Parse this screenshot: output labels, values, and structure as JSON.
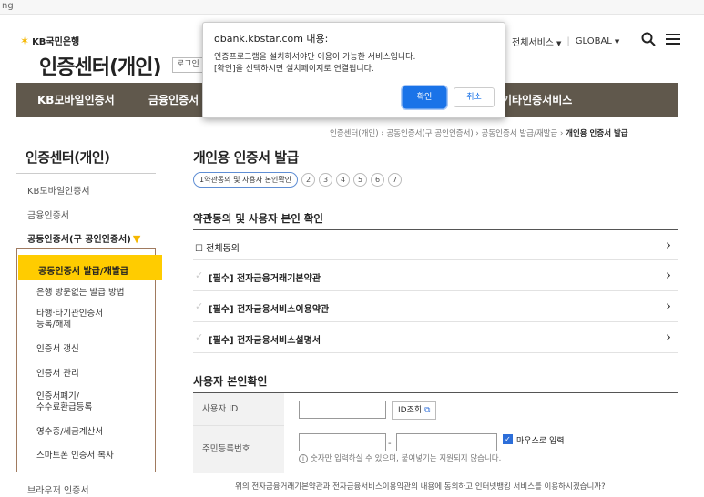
{
  "browser": {
    "tab_fragment": "ng"
  },
  "header": {
    "logo_text": "KB국민은행",
    "site_title": "인증센터(개인)",
    "login_label": "로그인",
    "all_services": "전체서비스",
    "global": "GLOBAL"
  },
  "nav": {
    "items": [
      "KB모바일인증서",
      "금융인증서",
      "기타인증서비스"
    ]
  },
  "breadcrumb": {
    "items": [
      "인증센터(개인)",
      "공동인증서(구 공인인증서)",
      "공동인증서 발급/재발급"
    ],
    "current": "개인용 인증서 발급"
  },
  "sidebar": {
    "title": "인증센터(개인)",
    "items": [
      "KB모바일인증서",
      "금융인증서",
      "공동인증서(구 공인인증서)"
    ],
    "subitems": [
      "공동인증서 발급/재발급",
      "은행 방문없는 발급 방법",
      "타행·타기관인증서\n등록/해제",
      "인증서 갱신",
      "인증서 관리",
      "인증서폐기/\n수수료환급등록",
      "영수증/세금계산서",
      "스마트폰 인증서 복사"
    ],
    "bottom_item": "브라우저 인증서"
  },
  "main": {
    "title": "개인용 인증서 발급",
    "steps": [
      "1약관동의 및 사용자 본인확인",
      "2",
      "3",
      "4",
      "5",
      "6",
      "7"
    ],
    "section_terms": "약관동의 및 사용자 본인 확인",
    "agree_all": "전체동의",
    "terms": [
      "[필수] 전자금융거래기본약관",
      "[필수] 전자금융서비스이용약관",
      "[필수] 전자금융서비스설명서"
    ],
    "section_identity": "사용자 본인확인",
    "form": {
      "user_id_label": "사용자 ID",
      "id_check_label": "ID조회",
      "rrn_label": "주민등록번호",
      "dash": "-",
      "mouse_input_label": "마우스로 입력",
      "note": "숫자만 입력하실 수 있으며, 붙여넣기는 지원되지 않습니다."
    },
    "bottom_text": "위의 전자금융거래기본약관과 전자금융서비스이용약관의 내용에 동의하고 인터넷뱅킹 서비스를 이용하시겠습니까?"
  },
  "dialog": {
    "title": "obank.kbstar.com 내용:",
    "line1": "인증프로그램을 설치하셔야만 이용이 가능한 서비스입니다.",
    "line2": "[확인]을 선택하시면 설치페이지로 연결됩니다.",
    "ok_label": "확인",
    "cancel_label": "취소"
  },
  "colors": {
    "nav_bg": "#60584c",
    "accent_yellow": "#ffcc00",
    "dialog_ok": "#1a73e8"
  }
}
